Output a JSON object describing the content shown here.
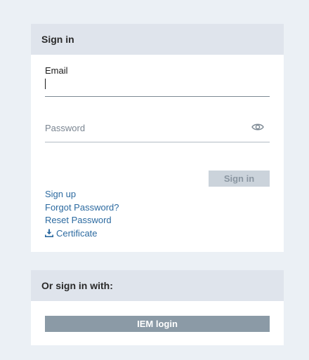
{
  "signin": {
    "title": "Sign in",
    "email_label": "Email",
    "email_value": "",
    "password_placeholder": "Password",
    "password_toggle_icon": "eye-icon",
    "submit_label": "Sign in",
    "links": {
      "sign_up": "Sign up",
      "forgot_password": "Forgot Password?",
      "reset_password": "Reset Password",
      "certificate": "Certificate",
      "certificate_icon": "download-icon"
    }
  },
  "alternate": {
    "title": "Or sign in with:",
    "iem_label": "IEM login"
  },
  "colors": {
    "background": "#ebf0f5",
    "header": "#dfe4ec",
    "link": "#2c6aa0",
    "disabled_button": "#cbd3db",
    "iem_button": "#8b9aa6"
  }
}
